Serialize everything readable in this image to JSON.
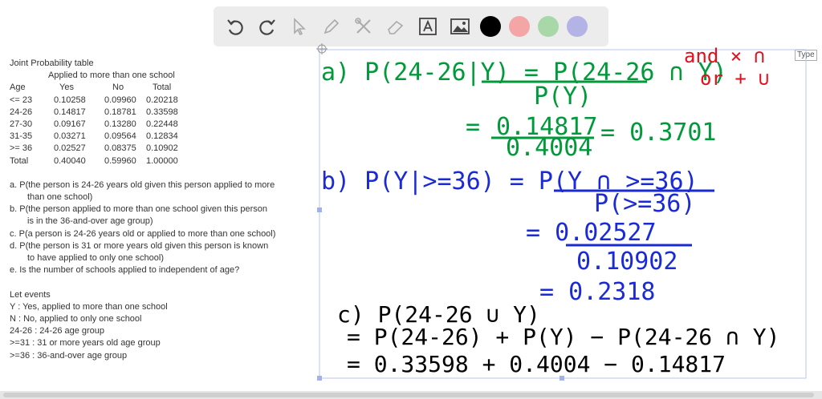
{
  "toolbar": {
    "tools": [
      "undo-icon",
      "redo-icon",
      "pointer-icon",
      "pen-icon",
      "tools-icon",
      "eraser-icon",
      "text-icon",
      "image-icon"
    ],
    "colors": [
      "#000000",
      "#f4a6a6",
      "#a8d8a8",
      "#b3b3e6"
    ]
  },
  "table": {
    "title": "Joint Probability table",
    "subtitle": "Applied to more than one school",
    "headers": [
      "Age",
      "Yes",
      "No",
      "Total"
    ],
    "rows": [
      [
        "<= 23",
        "0.10258",
        "0.09960",
        "0.20218"
      ],
      [
        "24-26",
        "0.14817",
        "0.18781",
        "0.33598"
      ],
      [
        "27-30",
        "0.09167",
        "0.13280",
        "0.22448"
      ],
      [
        "31-35",
        "0.03271",
        "0.09564",
        "0.12834"
      ],
      [
        ">= 36",
        "0.02527",
        "0.08375",
        "0.10902"
      ],
      [
        "Total",
        "0.40040",
        "0.59960",
        "1.00000"
      ]
    ]
  },
  "questions": [
    [
      "a. P(the person is 24-26 years old given this person applied to more",
      "than one school)"
    ],
    [
      "b. P(the person applied to more than one school given this person",
      "is in the 36-and-over age group)"
    ],
    [
      "c. P(a person is 24-26 years old or applied to more than one school)"
    ],
    [
      "d. P(the person is 31 or more years old given this person is known",
      "to have applied to only one school)"
    ],
    [
      "e. Is the number of schools applied to independent of age?"
    ]
  ],
  "events": {
    "title": "Let events",
    "items": [
      "Y : Yes, applied to more than one school",
      "N : No, applied to only one school",
      "24-26 : 24-26 age group",
      ">=31 : 31 or more years old age group",
      ">=36 : 36-and-over age group"
    ]
  },
  "type_box": "Type",
  "handwriting": {
    "note1": "and × ∩",
    "note2": "or + ∪",
    "a1": "a) P(24-26|Y) = P(24-26 ∩ Y)",
    "a1_den": "P(Y)",
    "a2_num": "0.14817",
    "a2_den": "0.4004",
    "a2_res": "= 0.3701",
    "b1": "b) P(Y|>=36) = P(Y ∩ >=36)",
    "b1_den": "P(>=36)",
    "b2_num": "= 0.02527",
    "b2_den": "0.10902",
    "b3": "= 0.2318",
    "c1": "c) P(24-26 ∪ Y)",
    "c2": "= P(24-26) + P(Y) − P(24-26 ∩ Y)",
    "c3": "= 0.33598 + 0.4004 − 0.14817"
  }
}
